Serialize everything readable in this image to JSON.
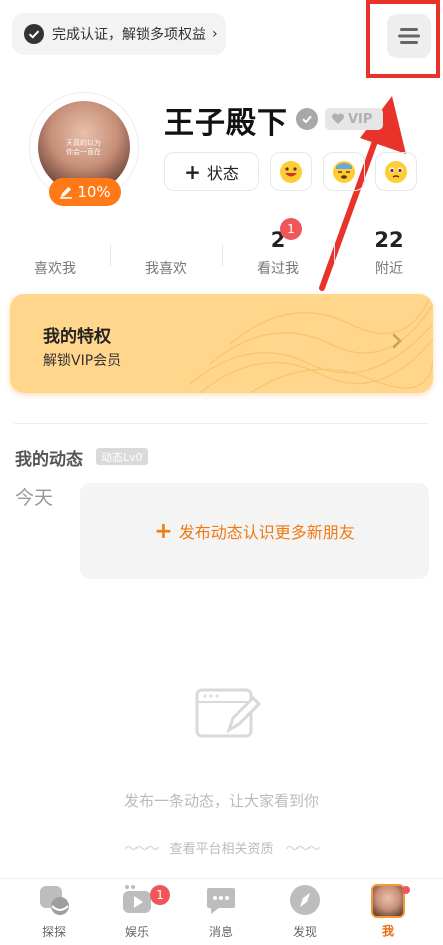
{
  "top": {
    "verify_text": "完成认证，解锁多项权益",
    "verify_chevron": "›"
  },
  "profile": {
    "name": "王子殿下",
    "vip_label": "VIP",
    "completion": "10%",
    "status_label": "状态",
    "avatar_watermark": [
      "天真的以为",
      "你会一直在"
    ],
    "emoji_buttons": [
      "grinning-face",
      "sleeping-face",
      "pleading-face"
    ]
  },
  "stats": [
    {
      "num": "",
      "label": "喜欢我"
    },
    {
      "num": "",
      "label": "我喜欢"
    },
    {
      "num": "2",
      "label": "看过我",
      "badge": "1"
    },
    {
      "num": "22",
      "label": "附近"
    }
  ],
  "privilege": {
    "title": "我的特权",
    "subtitle": "解锁VIP会员"
  },
  "moments": {
    "title": "我的动态",
    "level": "动态Lv0",
    "today": "今天",
    "post_prompt": "发布动态认识更多新朋友",
    "empty_text": "发布一条动态，让大家看到你",
    "more_text": "查看平台相关资质"
  },
  "nav": [
    {
      "label": "探探",
      "icon": "tantan-icon"
    },
    {
      "label": "娱乐",
      "icon": "play-icon",
      "badge": "1"
    },
    {
      "label": "消息",
      "icon": "chat-icon"
    },
    {
      "label": "发现",
      "icon": "compass-icon"
    },
    {
      "label": "我",
      "icon": "me-avatar",
      "active": true
    }
  ],
  "colors": {
    "accent": "#ff7a16",
    "highlight_box": "#e8332b",
    "privilege_bg": "#ffd68c",
    "badge": "#f0575b"
  }
}
